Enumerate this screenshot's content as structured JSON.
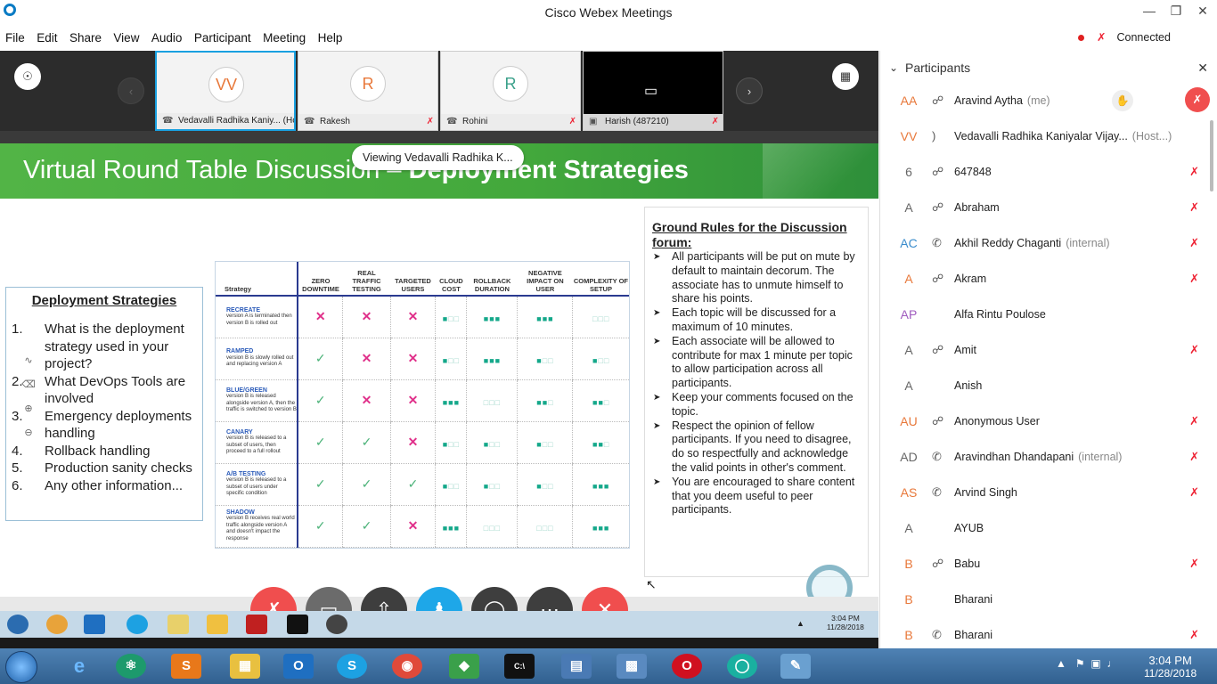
{
  "app": {
    "title": "Cisco Webex Meetings",
    "connection": "Connected"
  },
  "menu": [
    "File",
    "Edit",
    "Share",
    "View",
    "Audio",
    "Participant",
    "Meeting",
    "Help"
  ],
  "video_tiles": [
    {
      "initials": "VV",
      "name": "Vedavalli Radhika Kaniy... (Host...)",
      "color": "#e8783a"
    },
    {
      "initials": "R",
      "name": "Rakesh",
      "color": "#e8783a"
    },
    {
      "initials": "R",
      "name": "Rohini",
      "color": "#3aa08a"
    },
    {
      "initials": "",
      "name": "Harish (487210)",
      "color": "#000"
    }
  ],
  "viewing_pill": "Viewing Vedavalli Radhika K...",
  "slide": {
    "banner_prefix": "Virtual Round Table Discussion – ",
    "banner_bold": "Deployment Strategies",
    "left_title": "Deployment Strategies",
    "left_items": [
      {
        "n": "1.",
        "t": "What is the deployment strategy used in your project?"
      },
      {
        "n": "2.",
        "t": "What DevOps Tools are involved"
      },
      {
        "n": "3.",
        "t": "Emergency deployments handling"
      },
      {
        "n": "4.",
        "t": "Rollback handling"
      },
      {
        "n": "5.",
        "t": "Production sanity checks"
      },
      {
        "n": "6.",
        "t": "Any other information..."
      }
    ],
    "table": {
      "headers": [
        "Strategy",
        "ZERO DOWNTIME",
        "REAL TRAFFIC TESTING",
        "TARGETED USERS",
        "CLOUD COST",
        "ROLLBACK DURATION",
        "NEGATIVE IMPACT ON USER",
        "COMPLEXITY OF SETUP"
      ],
      "rows": [
        {
          "name": "RECREATE",
          "desc": "version A is terminated then version B is rolled out",
          "cells": [
            "x",
            "x",
            "x",
            "1",
            "3",
            "3",
            "0"
          ]
        },
        {
          "name": "RAMPED",
          "desc": "version B is slowly rolled out and replacing version A",
          "cells": [
            "v",
            "x",
            "x",
            "1",
            "3",
            "1",
            "1"
          ]
        },
        {
          "name": "BLUE/GREEN",
          "desc": "version B is released alongside version A, then the traffic is switched to version B",
          "cells": [
            "v",
            "x",
            "x",
            "3",
            "0",
            "2",
            "2"
          ]
        },
        {
          "name": "CANARY",
          "desc": "version B is released to a subset of users, then proceed to a full rollout",
          "cells": [
            "v",
            "v",
            "x",
            "1",
            "1",
            "1",
            "2"
          ]
        },
        {
          "name": "A/B TESTING",
          "desc": "version B is released to a subset of users under specific condition",
          "cells": [
            "v",
            "v",
            "v",
            "1",
            "1",
            "1",
            "3"
          ]
        },
        {
          "name": "SHADOW",
          "desc": "version B receives real world traffic alongside version A and doesn't impact the response",
          "cells": [
            "v",
            "v",
            "x",
            "3",
            "0",
            "0",
            "3"
          ]
        }
      ]
    },
    "rules_title": "Ground Rules for the Discussion forum:",
    "rules": [
      "All participants will be put on mute by default to maintain decorum. The associate has to unmute himself to share his points.",
      "Each topic will be discussed for a maximum of 10 minutes.",
      "Each associate will be allowed to contribute for max 1 minute per topic to allow participation across all participants.",
      "Keep your comments focused on the topic.",
      "Respect the opinion of fellow participants. If you need to disagree, do so respectfully and acknowledge the valid points in other's comment.",
      "You are encouraged to share content that you deem useful to peer participants."
    ]
  },
  "inner_clock": {
    "time": "3:04 PM",
    "date": "11/28/2018"
  },
  "participants_panel": {
    "title": "Participants",
    "people": [
      {
        "initials": "AA",
        "name": "Aravind Aytha",
        "sub": "(me)",
        "color": "#e8783a",
        "icon": "headset",
        "muted": true
      },
      {
        "initials": "VV",
        "name": "Vedavalli Radhika Kaniyalar Vijay...",
        "sub": "(Host...)",
        "color": "#e8783a",
        "icon": "speaker",
        "muted": false
      },
      {
        "initials": "6",
        "name": "647848",
        "sub": "",
        "color": "#666",
        "icon": "headset",
        "muted": true
      },
      {
        "initials": "A",
        "name": "Abraham",
        "sub": "",
        "color": "#666",
        "icon": "headset",
        "muted": true
      },
      {
        "initials": "AC",
        "name": "Akhil Reddy Chaganti",
        "sub": "(internal)",
        "color": "#3a8ccc",
        "icon": "phone",
        "muted": true
      },
      {
        "initials": "A",
        "name": "Akram",
        "sub": "",
        "color": "#e8783a",
        "icon": "headset",
        "muted": true
      },
      {
        "initials": "AP",
        "name": "Alfa Rintu Poulose",
        "sub": "",
        "color": "#a05cbf",
        "icon": "",
        "muted": false
      },
      {
        "initials": "A",
        "name": "Amit",
        "sub": "",
        "color": "#666",
        "icon": "headset",
        "muted": true
      },
      {
        "initials": "A",
        "name": "Anish",
        "sub": "",
        "color": "#666",
        "icon": "",
        "muted": false
      },
      {
        "initials": "AU",
        "name": "Anonymous User",
        "sub": "",
        "color": "#e8783a",
        "icon": "headset",
        "muted": true
      },
      {
        "initials": "AD",
        "name": "Aravindhan Dhandapani",
        "sub": "(internal)",
        "color": "#666",
        "icon": "phone",
        "muted": true
      },
      {
        "initials": "AS",
        "name": "Arvind Singh",
        "sub": "",
        "color": "#e8783a",
        "icon": "phone",
        "muted": true
      },
      {
        "initials": "A",
        "name": "AYUB",
        "sub": "",
        "color": "#666",
        "icon": "",
        "muted": false
      },
      {
        "initials": "B",
        "name": "Babu",
        "sub": "",
        "color": "#e8783a",
        "icon": "headset",
        "muted": true
      },
      {
        "initials": "B",
        "name": "Bharani",
        "sub": "",
        "color": "#e8783a",
        "icon": "",
        "muted": false
      },
      {
        "initials": "B",
        "name": "Bharani",
        "sub": "",
        "color": "#e8783a",
        "icon": "phone",
        "muted": true
      }
    ]
  },
  "taskbar": {
    "time": "3:04 PM",
    "date": "11/28/2018"
  }
}
